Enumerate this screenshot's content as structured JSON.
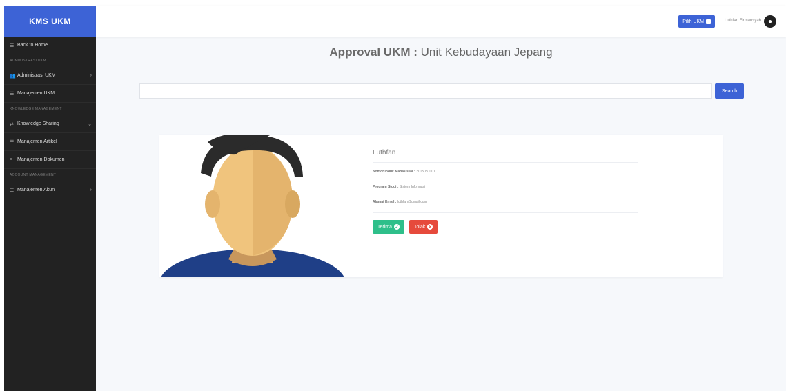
{
  "sidebar": {
    "brand": "KMS UKM",
    "items": [
      {
        "type": "item",
        "label": "Back to Home",
        "icon": "home-icon"
      },
      {
        "type": "heading",
        "label": "ADMINISTRASI UKM"
      },
      {
        "type": "item",
        "label": "Administrasi UKM",
        "icon": "users-icon",
        "chevron": true
      },
      {
        "type": "item",
        "label": "Manajemen UKM",
        "icon": "list-icon"
      },
      {
        "type": "heading",
        "label": "KNOWLEDGE MANAGEMENT"
      },
      {
        "type": "item",
        "label": "Knowledge Sharing",
        "icon": "share-icon",
        "chevron": true
      },
      {
        "type": "item",
        "label": "Manajemen Artikel",
        "icon": "article-icon"
      },
      {
        "type": "item",
        "label": "Manajemen Dokumen",
        "icon": "document-icon"
      },
      {
        "type": "heading",
        "label": "ACCOUNT MANAGEMENT"
      },
      {
        "type": "item",
        "label": "Manajemen Akun",
        "icon": "user-icon",
        "chevron": true
      }
    ]
  },
  "topbar": {
    "pilih_label": "Pilih UKM",
    "username": "Luthfan Firmansyah"
  },
  "page": {
    "title_prefix": "Approval UKM :",
    "title_unit": "Unit Kebudayaan Jepang"
  },
  "search": {
    "value": "",
    "placeholder": "",
    "button_label": "Search"
  },
  "applicant": {
    "name": "Luthfan",
    "nim_label": "Nomor Induk Mahasiswa :",
    "nim_value": "2015081001",
    "prodi_label": "Program Studi :",
    "prodi_value": "Sistem Informasi",
    "email_label": "Alamat Email :",
    "email_value": "luthfan@gmail.com",
    "accept_label": "Terima",
    "reject_label": "Tolak"
  },
  "colors": {
    "primary": "#3d63d6",
    "sidebar": "#222222",
    "success": "#2ebf8a",
    "danger": "#e64a3c"
  }
}
